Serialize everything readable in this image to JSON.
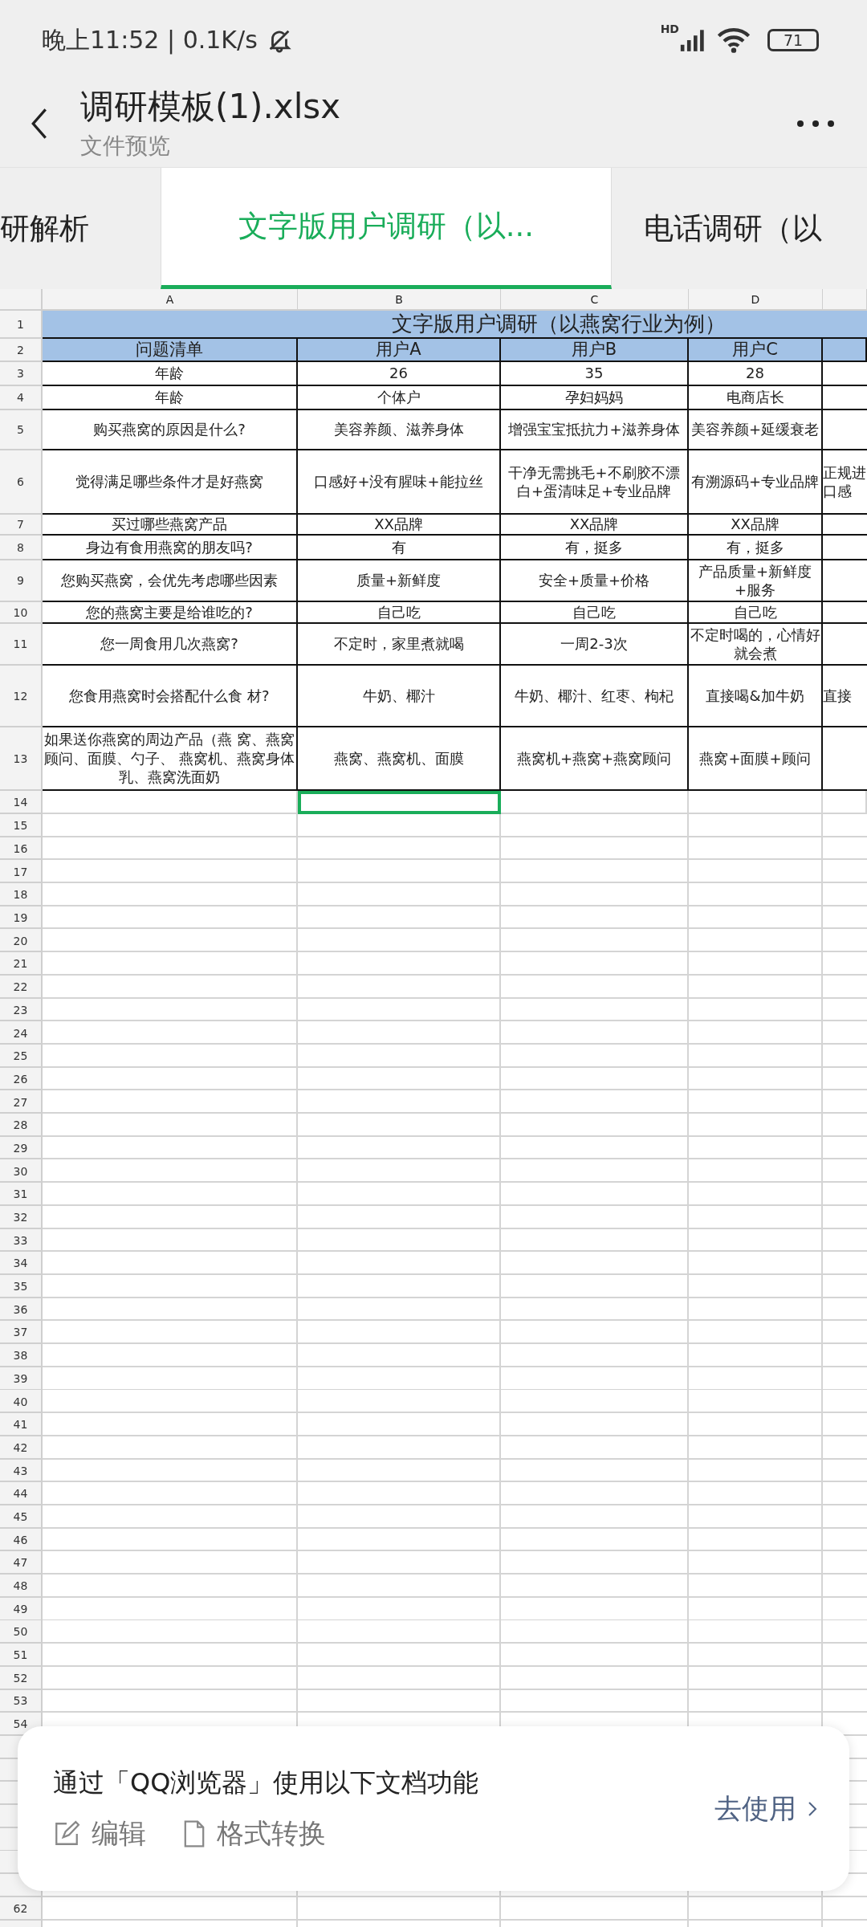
{
  "status_bar": {
    "time": "晚上11:52 | 0.1K/s",
    "network_label": "HD",
    "battery": "71"
  },
  "header": {
    "title": "调研模板(1).xlsx",
    "subtitle": "文件预览"
  },
  "sheet_tabs": [
    {
      "label": "研解析",
      "selected": false
    },
    {
      "label": "文字版用户调研（以...",
      "selected": true
    },
    {
      "label": "电话调研（以",
      "selected": false
    }
  ],
  "columns": [
    "A",
    "B",
    "C",
    "D"
  ],
  "rows": [
    {
      "number": "1",
      "kind": "title",
      "cells": [
        {
          "text": "文字版用户调研（以燕窝行业为例）"
        }
      ]
    },
    {
      "number": "2",
      "kind": "header",
      "cells": [
        {
          "text": "问题清单"
        },
        {
          "text": "用户A"
        },
        {
          "text": "用户B"
        },
        {
          "text": "用户C"
        },
        {}
      ]
    },
    {
      "number": "3",
      "kind": "data",
      "cells": [
        {
          "text": "年龄"
        },
        {
          "text": "26"
        },
        {
          "text": "35"
        },
        {
          "text": "28"
        },
        {}
      ]
    },
    {
      "number": "4",
      "kind": "data",
      "cells": [
        {
          "text": "年龄"
        },
        {
          "text": "个体户"
        },
        {
          "text": "孕妇妈妈"
        },
        {
          "text": "电商店长"
        },
        {}
      ]
    },
    {
      "number": "5",
      "kind": "data",
      "cells": [
        {
          "text": "购买燕窝的原因是什么?"
        },
        {
          "text": "美容养颜、滋养身体"
        },
        {
          "text": "增强宝宝抵抗力+滋养身体"
        },
        {
          "text": "美容养颜+延缓衰老"
        },
        {}
      ]
    },
    {
      "number": "6",
      "kind": "data",
      "cells": [
        {
          "text": "觉得满足哪些条件才是好燕窝"
        },
        {
          "text": "口感好+没有腥味+能拉丝"
        },
        {
          "text": "干净无需挑毛+不刷胶不漂白+蛋清味足+专业品牌"
        },
        {
          "text": "有溯源码+专业品牌"
        },
        {
          "text": "正规进口感"
        }
      ]
    },
    {
      "number": "7",
      "kind": "data",
      "cells": [
        {
          "text": "买过哪些燕窝产品"
        },
        {
          "text": "XX品牌"
        },
        {
          "text": "XX品牌"
        },
        {
          "text": "XX品牌"
        },
        {}
      ]
    },
    {
      "number": "8",
      "kind": "data",
      "cells": [
        {
          "text": "身边有食用燕窝的朋友吗?"
        },
        {
          "text": "有"
        },
        {
          "text": "有，挺多"
        },
        {
          "text": "有，挺多"
        },
        {}
      ]
    },
    {
      "number": "9",
      "kind": "data",
      "cells": [
        {
          "text": "您购买燕窝，会优先考虑哪些因素"
        },
        {
          "text": "质量+新鲜度"
        },
        {
          "text": "安全+质量+价格"
        },
        {
          "text": "产品质量+新鲜度+服务"
        },
        {}
      ]
    },
    {
      "number": "10",
      "kind": "data",
      "cells": [
        {
          "text": "您的燕窝主要是给谁吃的?"
        },
        {
          "text": "自己吃"
        },
        {
          "text": "自己吃"
        },
        {
          "text": "自己吃"
        },
        {}
      ]
    },
    {
      "number": "11",
      "kind": "data",
      "cells": [
        {
          "text": "您一周食用几次燕窝?"
        },
        {
          "text": "不定时，家里煮就喝"
        },
        {
          "text": "一周2-3次"
        },
        {
          "text": "不定时喝的，心情好就会煮"
        },
        {}
      ]
    },
    {
      "number": "12",
      "kind": "data",
      "cells": [
        {
          "text": "您食用燕窝时会搭配什么食 材?"
        },
        {
          "text": "牛奶、椰汁"
        },
        {
          "text": "牛奶、椰汁、红枣、枸杞"
        },
        {
          "text": "直接喝&加牛奶"
        },
        {
          "text": "直接"
        }
      ]
    },
    {
      "number": "13",
      "kind": "data",
      "cells": [
        {
          "text": "如果送你燕窝的周边产品（燕 窝、燕窝顾问、面膜、勺子、 燕窝机、燕窝身体乳、燕窝洗面奶"
        },
        {
          "text": "燕窝、燕窝机、面膜"
        },
        {
          "text": "燕窝机+燕窝+燕窝顾问"
        },
        {
          "text": "燕窝+面膜+顾问"
        },
        {}
      ]
    },
    {
      "number": "14",
      "kind": "empty",
      "cells": [
        {
          "selected": false
        },
        {
          "selected": true
        },
        {
          "selected": false
        },
        {
          "selected": false
        },
        {
          "selected": false
        }
      ]
    }
  ],
  "empty_rows": [
    "15",
    "16",
    "17",
    "18",
    "19",
    "20",
    "21",
    "22",
    "23",
    "24",
    "25",
    "26",
    "27",
    "28",
    "29",
    "30",
    "31",
    "32",
    "33",
    "34",
    "35",
    "36",
    "37",
    "38",
    "39",
    "40",
    "41",
    "42",
    "43",
    "44",
    "45",
    "46",
    "47",
    "48",
    "49",
    "50",
    "51",
    "52",
    "53",
    "54",
    "62"
  ],
  "banner": {
    "message": "通过「QQ浏览器」使用以下文档功能",
    "actions": [
      "编辑",
      "格式转换"
    ],
    "button": "去使用"
  }
}
